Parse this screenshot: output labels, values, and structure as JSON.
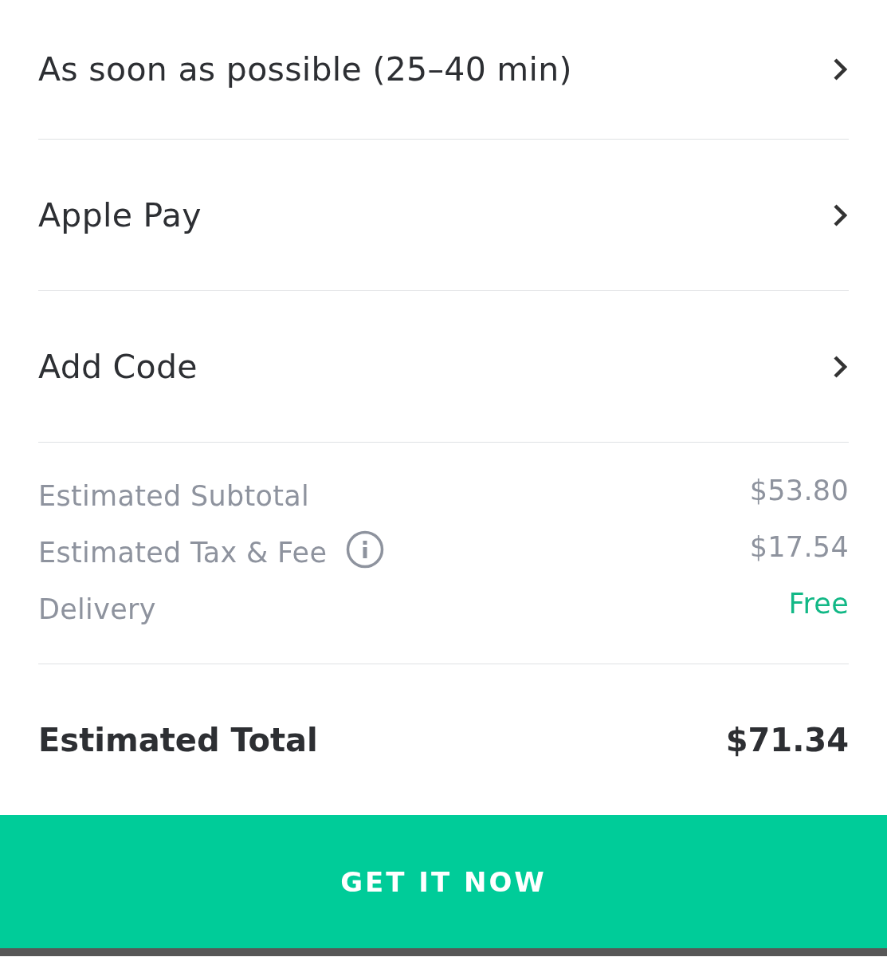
{
  "options": [
    {
      "label": "As soon as possible (25–40 min)"
    },
    {
      "label": "Apple Pay"
    },
    {
      "label": "Add Code"
    }
  ],
  "summary": [
    {
      "label": "Estimated Subtotal",
      "value": "$53.80",
      "info": false,
      "kind": "amount"
    },
    {
      "label": "Estimated Tax & Fee",
      "value": "$17.54",
      "info": true,
      "kind": "amount"
    },
    {
      "label": "Delivery",
      "value": "Free",
      "info": false,
      "kind": "free"
    }
  ],
  "total": {
    "label": "Estimated Total",
    "value": "$71.34"
  },
  "button": {
    "label": "GET IT NOW"
  }
}
